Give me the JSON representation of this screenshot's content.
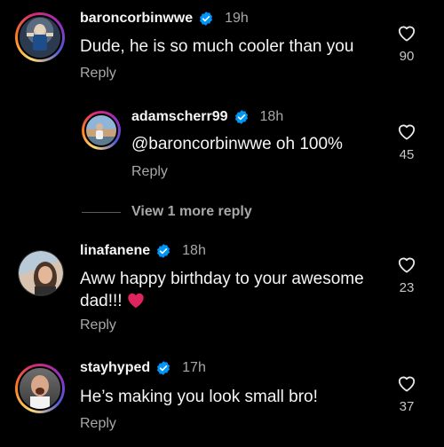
{
  "colors": {
    "background": "#000000",
    "text": "#f5f5f5",
    "muted": "#a8a8a8",
    "verified": "#0095f6",
    "heart_emoji": "#e0245e"
  },
  "comments": [
    {
      "username": "baroncorbinwwe",
      "verified": true,
      "time": "19h",
      "text": "Dude, he is so much cooler than you",
      "reply_label": "Reply",
      "likes": "90",
      "avatar_story_ring": true
    },
    {
      "username": "adamscherr99",
      "verified": true,
      "time": "18h",
      "text": "@baroncorbinwwe oh 100%",
      "reply_label": "Reply",
      "likes": "45",
      "avatar_story_ring": true,
      "is_reply": true
    },
    {
      "username": "linafanene",
      "verified": true,
      "time": "18h",
      "text_line1": "Aww happy birthday to your awesome",
      "text_line2": "dad!!!",
      "emoji": "red-heart",
      "reply_label": "Reply",
      "likes": "23",
      "avatar_story_ring": false
    },
    {
      "username": "stayhyped",
      "verified": true,
      "time": "17h",
      "text": "He’s making you look small bro!",
      "reply_label": "Reply",
      "likes": "37",
      "avatar_story_ring": true
    }
  ],
  "view_more_replies": "View 1 more reply",
  "icons": {
    "like": "heart-outline-icon",
    "verified": "verified-badge-icon"
  }
}
